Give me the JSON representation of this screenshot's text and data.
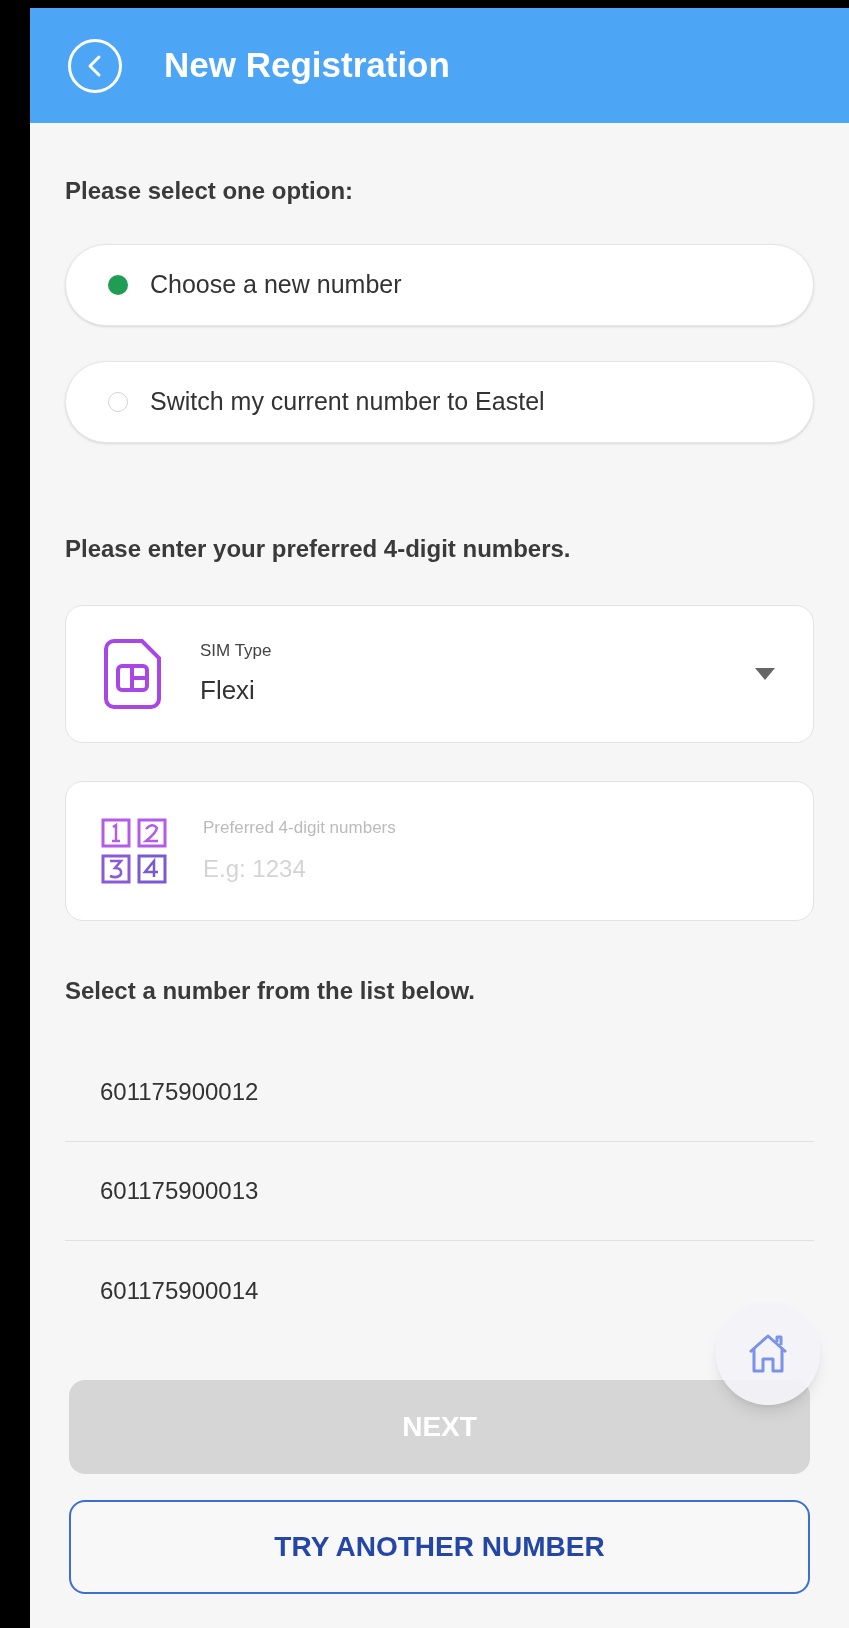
{
  "header": {
    "title": "New Registration"
  },
  "option_prompt": "Please select one option:",
  "options": [
    {
      "label": "Choose a new number",
      "selected": true
    },
    {
      "label": "Switch my current number to Eastel",
      "selected": false
    }
  ],
  "preferred_prompt": "Please enter your preferred 4-digit numbers.",
  "sim_type": {
    "label": "SIM Type",
    "value": "Flexi"
  },
  "preferred_field": {
    "label": "Preferred 4-digit numbers",
    "placeholder": "E.g: 1234"
  },
  "list_prompt": "Select a number from the list below.",
  "numbers": [
    {
      "label": "601175900012",
      "selected": false
    },
    {
      "label": "601175900013",
      "selected": false
    },
    {
      "label": "601175900014",
      "selected": false
    }
  ],
  "next_button": {
    "label": "NEXT",
    "disabled": true
  },
  "try_button": {
    "label": "TRY ANOTHER NUMBER"
  }
}
